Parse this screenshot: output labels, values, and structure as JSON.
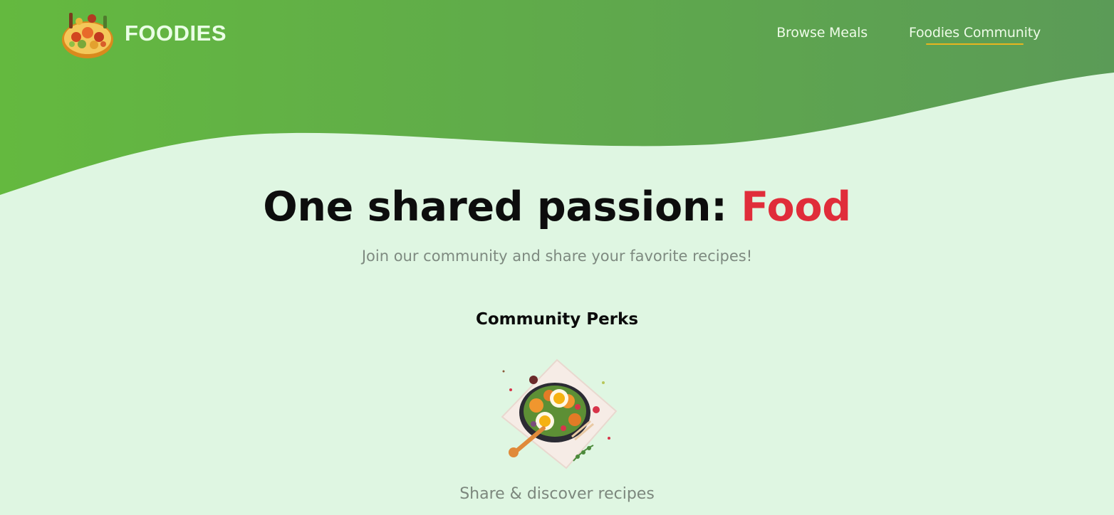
{
  "header": {
    "brand_name": "FOODIES",
    "logo_icon": "food-platter-icon",
    "nav": [
      {
        "label": "Browse Meals",
        "active": false
      },
      {
        "label": "Foodies Community",
        "active": true
      }
    ]
  },
  "hero": {
    "title_prefix": "One shared passion: ",
    "title_accent": "Food",
    "subtitle": "Join our community and share your favorite recipes!"
  },
  "perks": {
    "heading": "Community Perks",
    "items": [
      {
        "illustration": "recipe-dish-illustration",
        "caption": "Share & discover recipes"
      }
    ]
  },
  "colors": {
    "header_gradient_start": "#64b93f",
    "header_gradient_end": "#5b9b57",
    "background": "#dff6e2",
    "accent_red": "#e02d3a",
    "nav_underline": "#e8b51f"
  }
}
